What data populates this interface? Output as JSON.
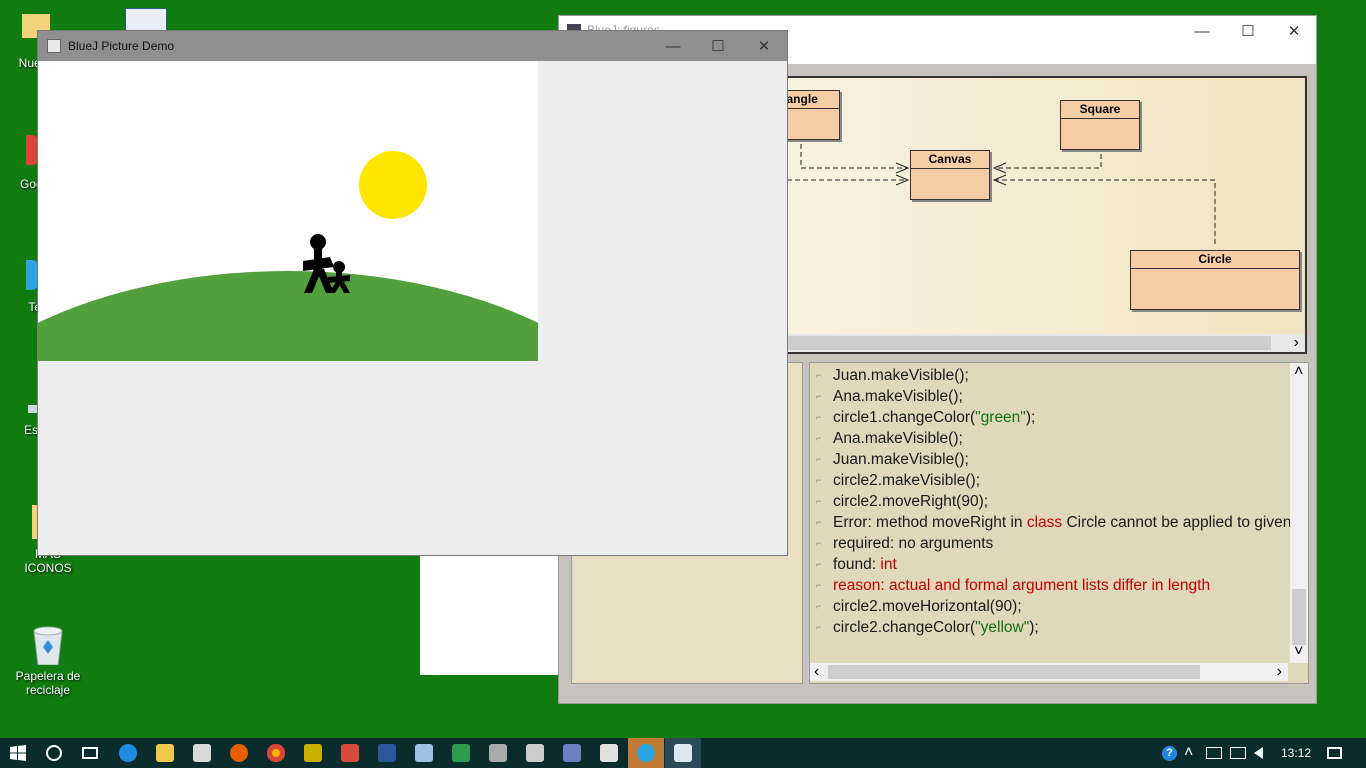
{
  "desktop": {
    "icons": [
      {
        "label": "Nuevo"
      },
      {
        "label": "Googl"
      },
      {
        "label": "Tel"
      },
      {
        "label": "Este"
      },
      {
        "label": "MAS ICONOS"
      },
      {
        "label": "Papelera de reciclaje"
      }
    ]
  },
  "bluej_window": {
    "title": "BlueJ: figures",
    "minimize_glyph": "—",
    "maximize_glyph": "☐",
    "close_glyph": "✕",
    "classes": [
      "iangle",
      "Square",
      "Canvas",
      "Circle"
    ],
    "scroll_right": "›"
  },
  "terminal": {
    "lines": [
      {
        "parts": [
          {
            "t": "Juan.makeVisible();"
          }
        ]
      },
      {
        "parts": [
          {
            "t": "Ana.makeVisible();"
          }
        ]
      },
      {
        "parts": [
          {
            "t": "circle1.changeColor("
          },
          {
            "t": "\"green\"",
            "c": "grn"
          },
          {
            "t": ");"
          }
        ]
      },
      {
        "parts": [
          {
            "t": "Ana.makeVisible();"
          }
        ]
      },
      {
        "parts": [
          {
            "t": "Juan.makeVisible();"
          }
        ]
      },
      {
        "parts": [
          {
            "t": "circle2.makeVisible();"
          }
        ]
      },
      {
        "parts": [
          {
            "t": "circle2.moveRight(90);"
          }
        ]
      },
      {
        "parts": [
          {
            "t": "Error: method moveRight in "
          },
          {
            "t": "class",
            "c": "red"
          },
          {
            "t": " Circle cannot be applied to given"
          }
        ]
      },
      {
        "parts": [
          {
            "t": "  required: no arguments"
          }
        ]
      },
      {
        "parts": [
          {
            "t": "  found: "
          },
          {
            "t": "int",
            "c": "red"
          }
        ]
      },
      {
        "parts": [
          {
            "t": "  reason: actual and formal argument lists differ in length",
            "c": "red"
          }
        ]
      },
      {
        "parts": [
          {
            "t": "circle2.moveHorizontal(90);"
          }
        ]
      },
      {
        "parts": [
          {
            "t": "circle2.changeColor("
          },
          {
            "t": "\"yellow\"",
            "c": "grn"
          },
          {
            "t": ");"
          }
        ]
      }
    ],
    "scroll_up": "˄",
    "scroll_down": "˅",
    "scroll_left": "‹",
    "scroll_right": "›"
  },
  "picture_window": {
    "title": "BlueJ Picture Demo",
    "minimize_glyph": "—",
    "maximize_glyph": "☐",
    "close_glyph": "✕"
  },
  "scene": {
    "sky_color": "#ffffff",
    "hill_color": "#52a03c",
    "sun_color": "#ffe600",
    "figure_color": "#000000"
  },
  "taskbar": {
    "start_icon": "windows-logo-icon",
    "apps": [
      "search-icon",
      "task-view-icon",
      "edge-icon",
      "file-explorer-icon",
      "store-icon",
      "firefox-icon",
      "chrome-icon",
      "app-icon",
      "app-icon",
      "word-icon",
      "app-icon",
      "app-icon",
      "app-icon",
      "app-icon",
      "app-icon",
      "app-icon",
      "telegram-icon",
      "bluej-icon"
    ],
    "clock": "13:12",
    "tray_symbols": [
      "?",
      "˄"
    ]
  }
}
